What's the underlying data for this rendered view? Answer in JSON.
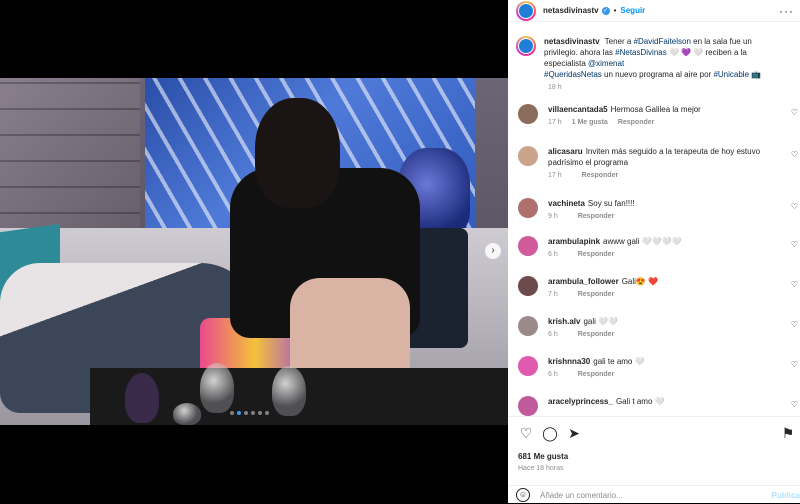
{
  "post": {
    "username": "netasdivinastv",
    "follow_label": "Seguir",
    "caption_parts": {
      "lead": "Tener a ",
      "tag1": "#DavidFaitelson",
      "mid1": " en la sala fue un privilegio. ahora las ",
      "tag2": "#NetasDivinas",
      "mid2": " 🤍 💜 🤍 reciben a la especialista ",
      "mention": "@ximenat",
      "tag3": "#QueridasNetas",
      "mid3": " un nuevo programa al aire por ",
      "tag4": "#Unicable",
      "tail": " 📺"
    },
    "caption_time": "18 h",
    "likes": "681 Me gusta",
    "posted_ago": "Hace 18 horas",
    "add_comment_placeholder": "Añade un comentario...",
    "publish_label": "Publica"
  },
  "comments": [
    {
      "user": "villaencantada5",
      "text": "Hermosa Galilea la mejor",
      "time": "17 h",
      "likes": "1 Me gusta",
      "reply": "Responder",
      "avatar_color": "#8a6d5a"
    },
    {
      "user": "alicasaru",
      "text": "Inviten más seguido a la terapeuta de hoy estuvo padrísimo el programa",
      "time": "17 h",
      "likes": "",
      "reply": "Responder",
      "avatar_color": "#c9a48a"
    },
    {
      "user": "vachineta",
      "text": "Soy su fan!!!!",
      "time": "9 h",
      "likes": "",
      "reply": "Responder",
      "avatar_color": "#b07070"
    },
    {
      "user": "arambulapink",
      "text": "awww gali 🤍🤍🤍🤍",
      "time": "6 h",
      "likes": "",
      "reply": "Responder",
      "avatar_color": "#d05a9a"
    },
    {
      "user": "arambula_follower",
      "text": "Gali😍 ❤️",
      "time": "7 h",
      "likes": "",
      "reply": "Responder",
      "avatar_color": "#6a4a4a"
    },
    {
      "user": "krish.alv",
      "text": "gali 🤍🤍",
      "time": "6 h",
      "likes": "",
      "reply": "Responder",
      "avatar_color": "#9a8a8a"
    },
    {
      "user": "krishnna30",
      "text": "gali te amo 🤍",
      "time": "6 h",
      "likes": "",
      "reply": "Responder",
      "avatar_color": "#e05ab0"
    },
    {
      "user": "aracelyprincess_",
      "text": "Gali t amo 🤍",
      "time": "",
      "likes": "",
      "reply": "",
      "avatar_color": "#c05a9a"
    }
  ],
  "icons": {
    "heart": "heart-icon",
    "comment": "comment-icon",
    "share": "share-icon",
    "save": "save-icon",
    "emoji": "emoji-icon",
    "more": "more-options-icon",
    "next": "chevron-right-icon"
  },
  "colors": {
    "accent": "#0095f6",
    "verified": "#3897f0",
    "muted": "#8e8e8e"
  },
  "carousel": {
    "active_index": 1,
    "count": 6
  }
}
